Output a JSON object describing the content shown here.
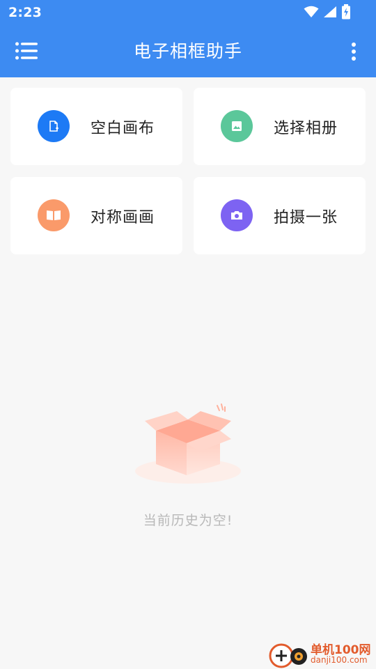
{
  "status": {
    "time": "2:23"
  },
  "appbar": {
    "title": "电子相框助手"
  },
  "actions": [
    {
      "label": "空白画布",
      "color": "#1d7af5",
      "icon": "blank-canvas-icon"
    },
    {
      "label": "选择相册",
      "color": "#5bc79a",
      "icon": "image-icon"
    },
    {
      "label": "对称画画",
      "color": "#fa9a6a",
      "icon": "symmetry-book-icon"
    },
    {
      "label": "拍摄一张",
      "color": "#7d63f2",
      "icon": "camera-icon"
    }
  ],
  "empty": {
    "message": "当前历史为空!"
  },
  "watermark": {
    "brand": "单机100网",
    "url": "danji100.com"
  }
}
